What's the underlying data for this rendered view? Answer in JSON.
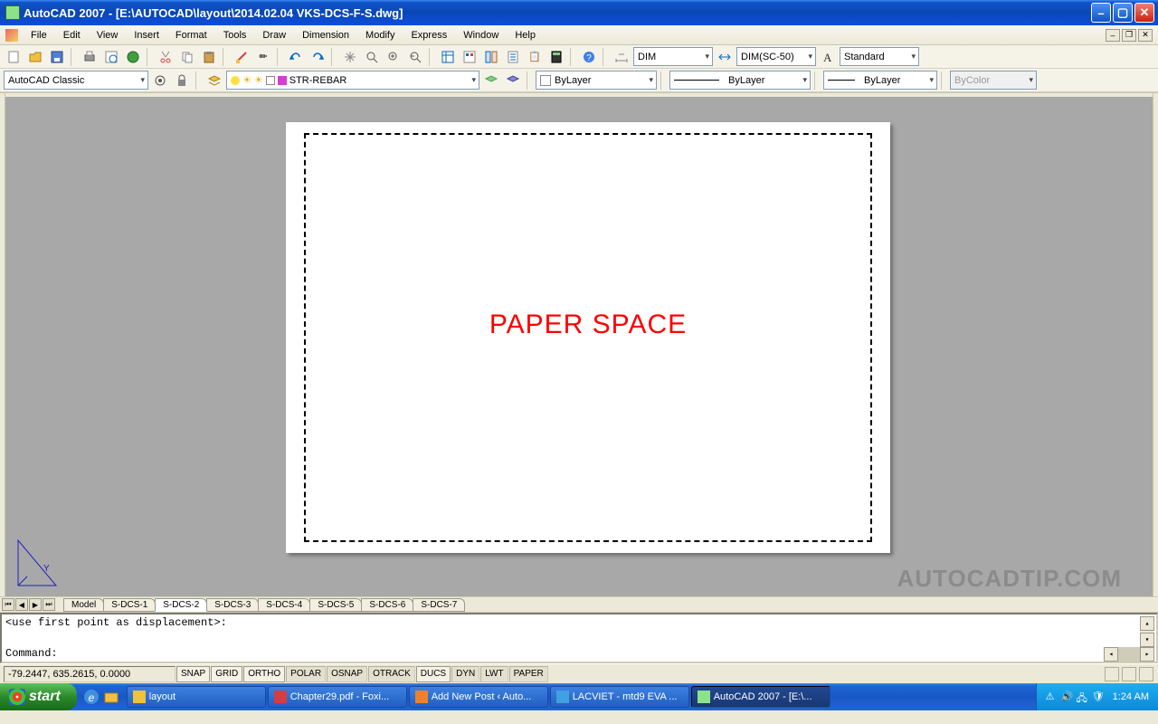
{
  "window": {
    "title": "AutoCAD 2007 - [E:\\AUTOCAD\\layout\\2014.02.04 VKS-DCS-F-S.dwg]"
  },
  "menu": [
    "File",
    "Edit",
    "View",
    "Insert",
    "Format",
    "Tools",
    "Draw",
    "Dimension",
    "Modify",
    "Express",
    "Window",
    "Help"
  ],
  "tb1": {
    "workspace": "AutoCAD Classic",
    "layer": "STR-REBAR",
    "dim": "DIM",
    "dim2": "DIM(SC-50)",
    "style": "Standard"
  },
  "tb2": {
    "color": "ByLayer",
    "ltype": "ByLayer",
    "lweight": "ByLayer",
    "plot": "ByColor"
  },
  "canvas": {
    "label": "PAPER SPACE"
  },
  "watermark": "AUTOCADTIP.COM",
  "tabs": [
    "Model",
    "S-DCS-1",
    "S-DCS-2",
    "S-DCS-3",
    "S-DCS-4",
    "S-DCS-5",
    "S-DCS-6",
    "S-DCS-7"
  ],
  "active_tab": 2,
  "cmd": {
    "l1": "<use first point as displacement>:",
    "l2": "Command:"
  },
  "status": {
    "coords": "-79.2447, 635.2615, 0.0000",
    "toggles": [
      "SNAP",
      "GRID",
      "ORTHO",
      "POLAR",
      "OSNAP",
      "OTRACK",
      "DUCS",
      "DYN",
      "LWT",
      "PAPER"
    ],
    "active": [
      3,
      4,
      5,
      7,
      8,
      9
    ]
  },
  "taskbar": {
    "start": "start",
    "items": [
      {
        "label": "layout",
        "active": false
      },
      {
        "label": "Chapter29.pdf - Foxi...",
        "active": false
      },
      {
        "label": "Add New Post ‹ Auto...",
        "active": false
      },
      {
        "label": "LACVIET - mtd9 EVA ...",
        "active": false
      },
      {
        "label": "AutoCAD 2007 - [E:\\...",
        "active": true
      }
    ],
    "clock": "1:24 AM"
  }
}
